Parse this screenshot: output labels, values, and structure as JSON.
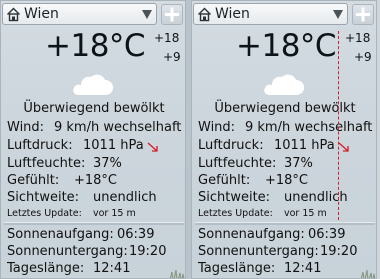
{
  "panels": [
    {
      "city": "Wien",
      "temperature": "+18°C",
      "high": "+18",
      "low": "+9",
      "condition": "Überwiegend bewölkt",
      "details": {
        "wind_label": "Wind:",
        "wind_value": "9 km/h wechselhaft",
        "pressure_label": "Luftdruck:",
        "pressure_value": "1011 hPa",
        "humidity_label": "Luftfeuchte:",
        "humidity_value": "37%",
        "feels_label": "Gefühlt:",
        "feels_value": "+18°C",
        "visibility_label": "Sichtweite:",
        "visibility_value": "unendlich",
        "update_label": "Letztes Update:",
        "update_value": "vor 15 m"
      },
      "sun": {
        "rise_label": "Sonnenaufgang:",
        "rise_value": "06:39",
        "set_label": "Sonnenuntergang:",
        "set_value": "19:20",
        "length_label": "Tageslänge:",
        "length_value": "12:41"
      }
    },
    {
      "city": "Wien",
      "temperature": "+18°C",
      "high": "+18",
      "low": "+9",
      "condition": "Überwiegend bewölkt",
      "details": {
        "wind_label": "Wind:",
        "wind_value": "9 km/h wechselhaft",
        "pressure_label": "Luftdruck:",
        "pressure_value": "1011 hPa",
        "humidity_label": "Luftfeuchte:",
        "humidity_value": "37%",
        "feels_label": "Gefühlt:",
        "feels_value": "+18°C",
        "visibility_label": "Sichtweite:",
        "visibility_value": "unendlich",
        "update_label": "Letztes Update:",
        "update_value": "vor 15 m"
      },
      "sun": {
        "rise_label": "Sonnenaufgang:",
        "rise_value": "06:39",
        "set_label": "Sonnenuntergang:",
        "set_value": "19:20",
        "length_label": "Tageslänge:",
        "length_value": "12:41"
      }
    }
  ],
  "icons": {
    "home": "home-icon",
    "dropdown": "triangle-down-icon",
    "add": "plus-icon",
    "weather": "cloud-icon",
    "pressure_trend": "arrow-down-right-icon"
  },
  "colors": {
    "background": "#cdd6dd",
    "text": "#111111",
    "pressure_arrow": "#d21d2a",
    "guide_line": "#d21d2a"
  }
}
